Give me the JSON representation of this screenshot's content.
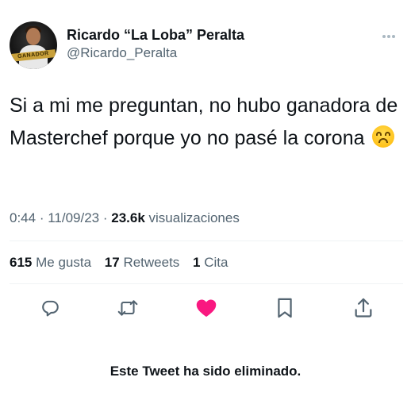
{
  "author": {
    "display_name": "Ricardo “La Loba” Peralta",
    "handle": "@Ricardo_Peralta",
    "avatar_banner_text": "GANADOR"
  },
  "tweet": {
    "text": "Si a mi me preguntan, no hubo ganadora de Masterchef porque yo no pasé la corona",
    "emoji": "upside-down-face-emoji"
  },
  "meta": {
    "time": "0:44",
    "separator1": " · ",
    "date": "11/09/23",
    "separator2": " · ",
    "views_count": "23.6k",
    "views_label": " visualizaciones"
  },
  "stats": {
    "likes_count": "615",
    "likes_label": "Me gusta",
    "retweets_count": "17",
    "retweets_label": "Retweets",
    "quotes_count": "1",
    "quotes_label": "Cita"
  },
  "actions": [
    {
      "name": "reply-icon"
    },
    {
      "name": "retweet-icon"
    },
    {
      "name": "like-icon",
      "color": "#f91880"
    },
    {
      "name": "bookmark-icon"
    },
    {
      "name": "share-icon"
    }
  ],
  "footer": {
    "deleted_notice": "Este Tweet ha sido eliminado."
  },
  "colors": {
    "icon": "#536471",
    "like": "#f91880",
    "text": "#0f1419",
    "muted": "#536471"
  }
}
